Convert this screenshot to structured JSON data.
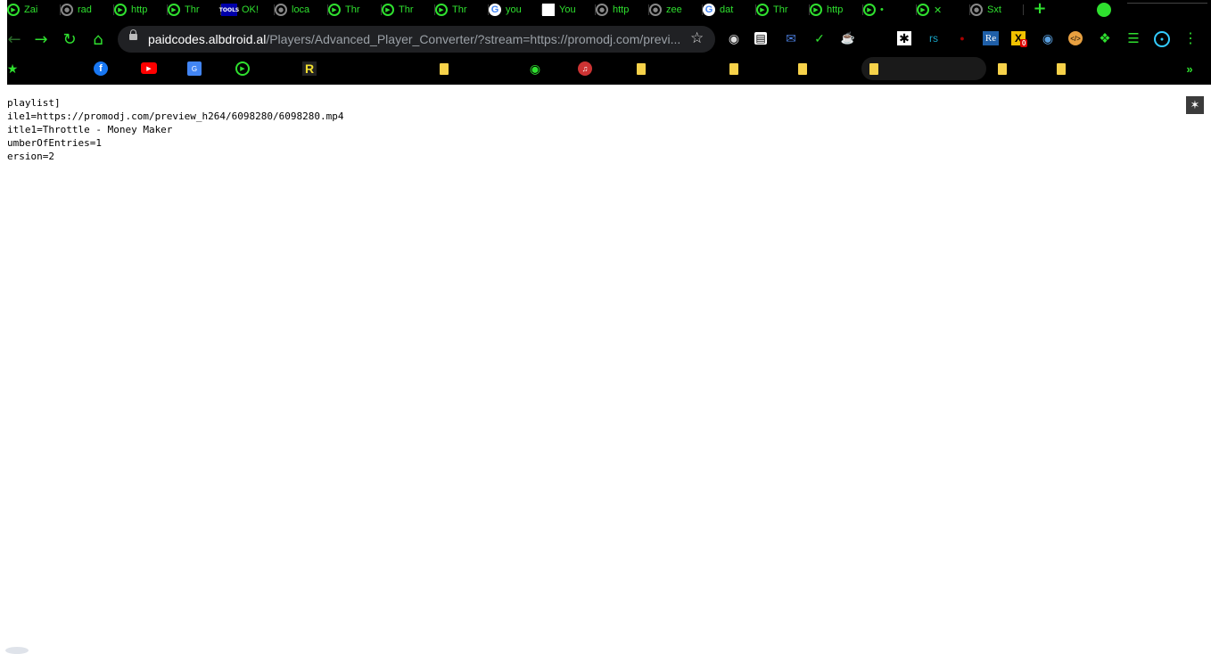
{
  "tabs": [
    {
      "title": "Zai",
      "icon": "play-icon"
    },
    {
      "title": "rad",
      "icon": "globe-grey-icon"
    },
    {
      "title": "http",
      "icon": "play-icon"
    },
    {
      "title": "Thr",
      "icon": "play-icon"
    },
    {
      "title": "OK!",
      "icon": "tools-icon",
      "icon_text": "TOOLS"
    },
    {
      "title": "loca",
      "icon": "globe-grey-icon"
    },
    {
      "title": "Thr",
      "icon": "play-icon"
    },
    {
      "title": "Thr",
      "icon": "play-icon"
    },
    {
      "title": "Thr",
      "icon": "play-icon"
    },
    {
      "title": "you",
      "icon": "google-icon",
      "icon_text": "G"
    },
    {
      "title": "You",
      "icon": "white-square-icon"
    },
    {
      "title": "http",
      "icon": "globe-grey-icon"
    },
    {
      "title": "zee",
      "icon": "globe-grey-icon"
    },
    {
      "title": "dat",
      "icon": "google-icon",
      "icon_text": "G"
    },
    {
      "title": "Thr",
      "icon": "play-icon"
    },
    {
      "title": "http",
      "icon": "play-icon"
    },
    {
      "title": "•",
      "icon": "play-icon"
    },
    {
      "title": "✕",
      "icon": "play-icon"
    },
    {
      "title": "Sxt",
      "icon": "globe-grey-icon"
    }
  ],
  "new_tab_label": "+",
  "address": {
    "host": "paidcodes.albdroid.al",
    "path": "/Players/Advanced_Player_Converter/?stream=https://promodj.com/previ..."
  },
  "extensions": {
    "rs_label": "rs",
    "re_label": "Re",
    "badge_count": "0"
  },
  "bookmarks": {
    "r_label": "R"
  },
  "page_lines": [
    "playlist]",
    "ile1=https://promodj.com/preview_h264/6098280/6098280.mp4",
    "itle1=Throttle - Money Maker",
    "umberOfEntries=1",
    "ersion=2"
  ],
  "colors": {
    "accent": "#2fe02f",
    "chrome_bg": "#000000",
    "omnibox_bg": "#202124"
  }
}
